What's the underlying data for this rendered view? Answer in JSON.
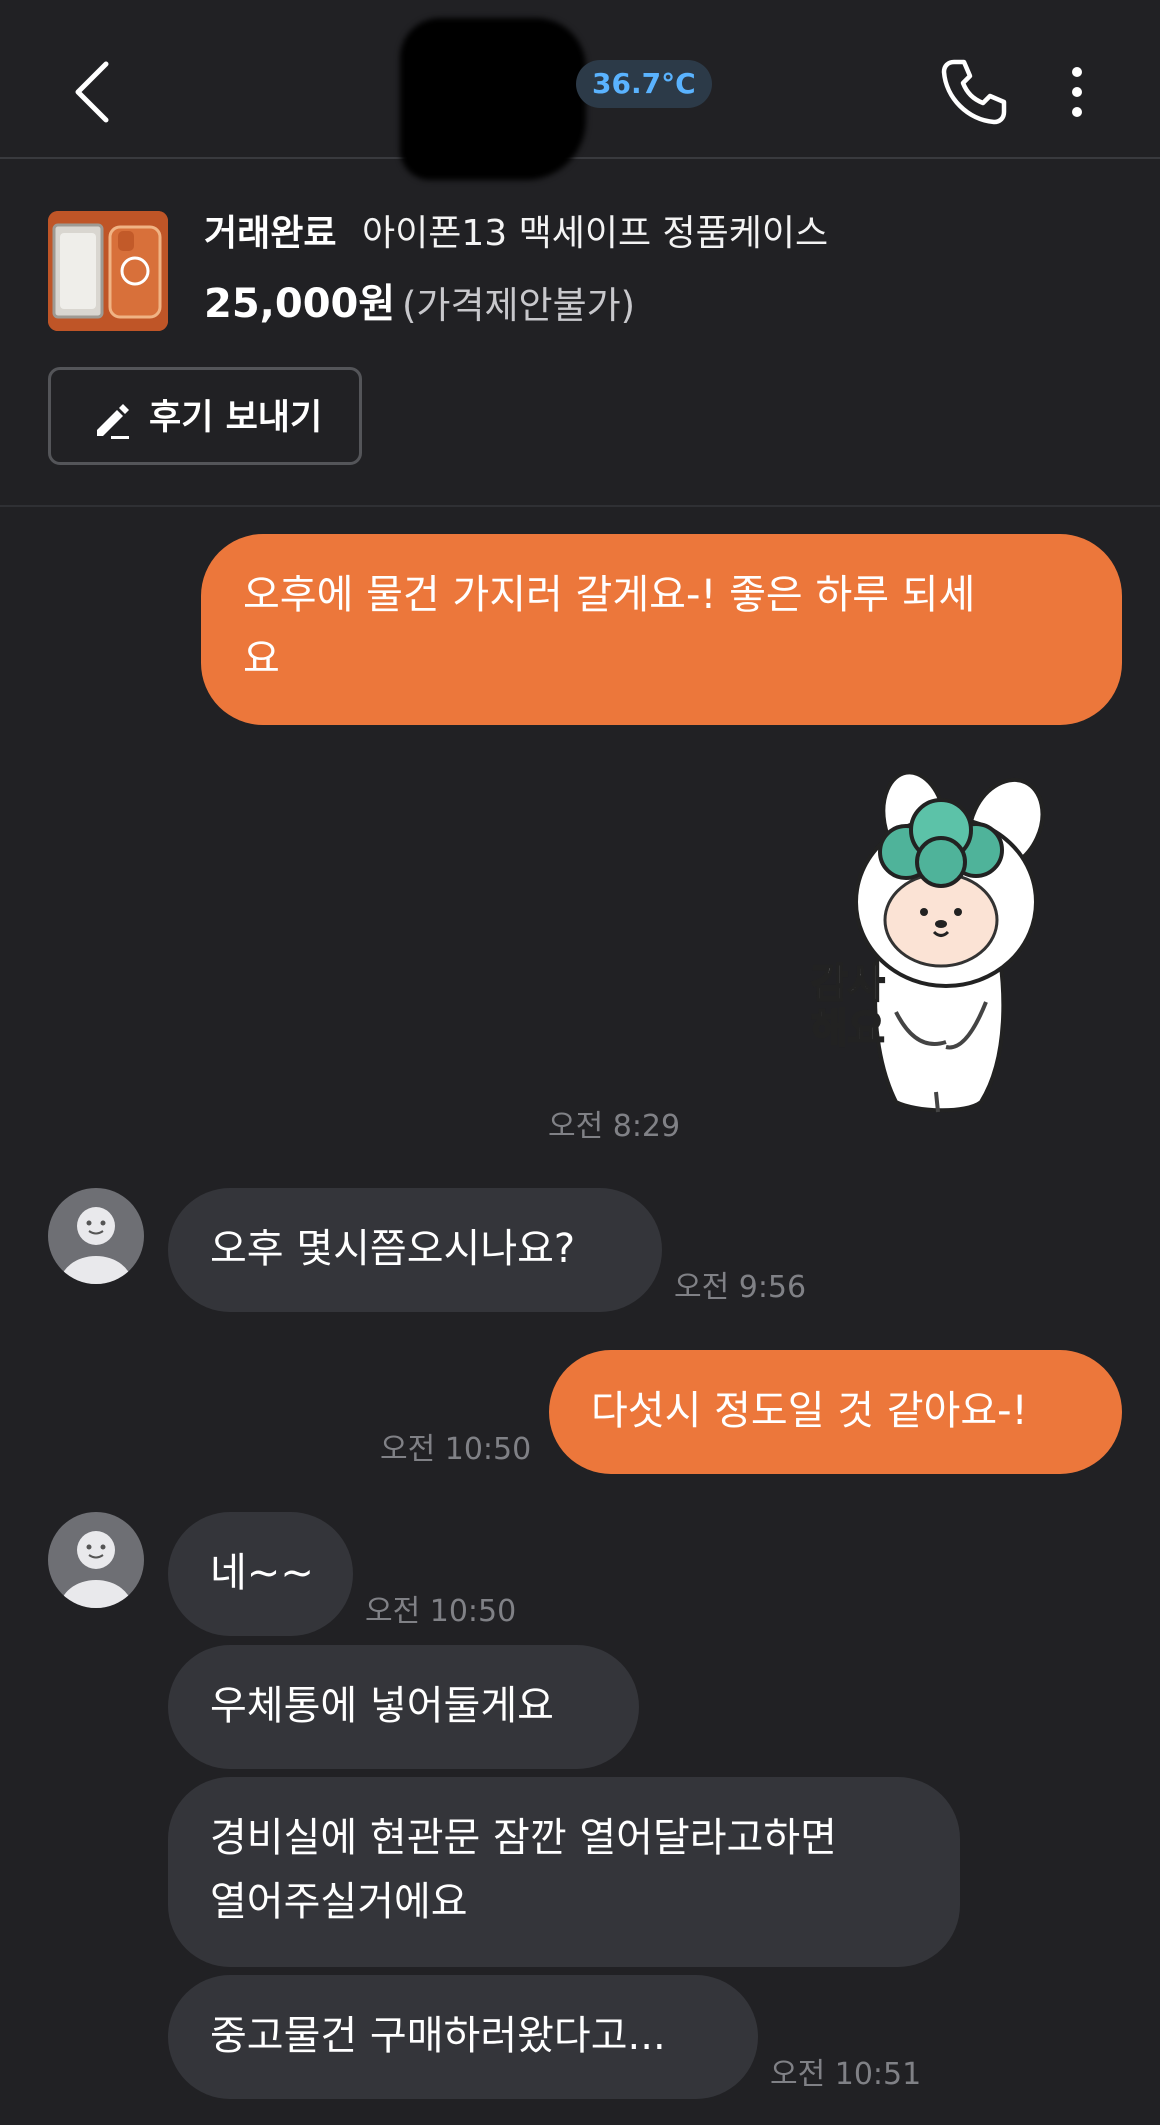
{
  "header": {
    "temperature": "36.7°C",
    "icons": {
      "back": "chevron-left-icon",
      "call": "phone-icon",
      "more": "more-vertical-icon"
    }
  },
  "product": {
    "status": "거래완료",
    "title": "아이폰13 맥세이프 정품케이스",
    "price": "25,000원",
    "price_note": "(가격제안불가)",
    "review_button": "후기 보내기"
  },
  "messages": {
    "m1": "오후에 물건 가지러 갈게요-! 좋은 하루 되세",
    "m1_line2": "요",
    "sticker_text": [
      "감사",
      "해요"
    ],
    "t1": "오전 8:29",
    "m2": "오후 몇시쯤오시나요?",
    "t2": "오전 9:56",
    "m3": "다섯시 정도일 것 같아요-!",
    "t3": "오전 10:50",
    "m4": "네~~",
    "t4": "오전 10:50",
    "m5": "우체통에 넣어둘게요",
    "m6_line1": "경비실에 현관문 잠깐 열어달라고하면",
    "m6_line2": "열어주실거에요",
    "m7": "중고물건 구매하러왔다고...",
    "t7": "오전 10:51"
  },
  "colors": {
    "background": "#212124",
    "sent_bubble": "#ec773b",
    "received_bubble": "#34353a",
    "temperature": "#5ab3ff",
    "timestamp": "#808186"
  }
}
